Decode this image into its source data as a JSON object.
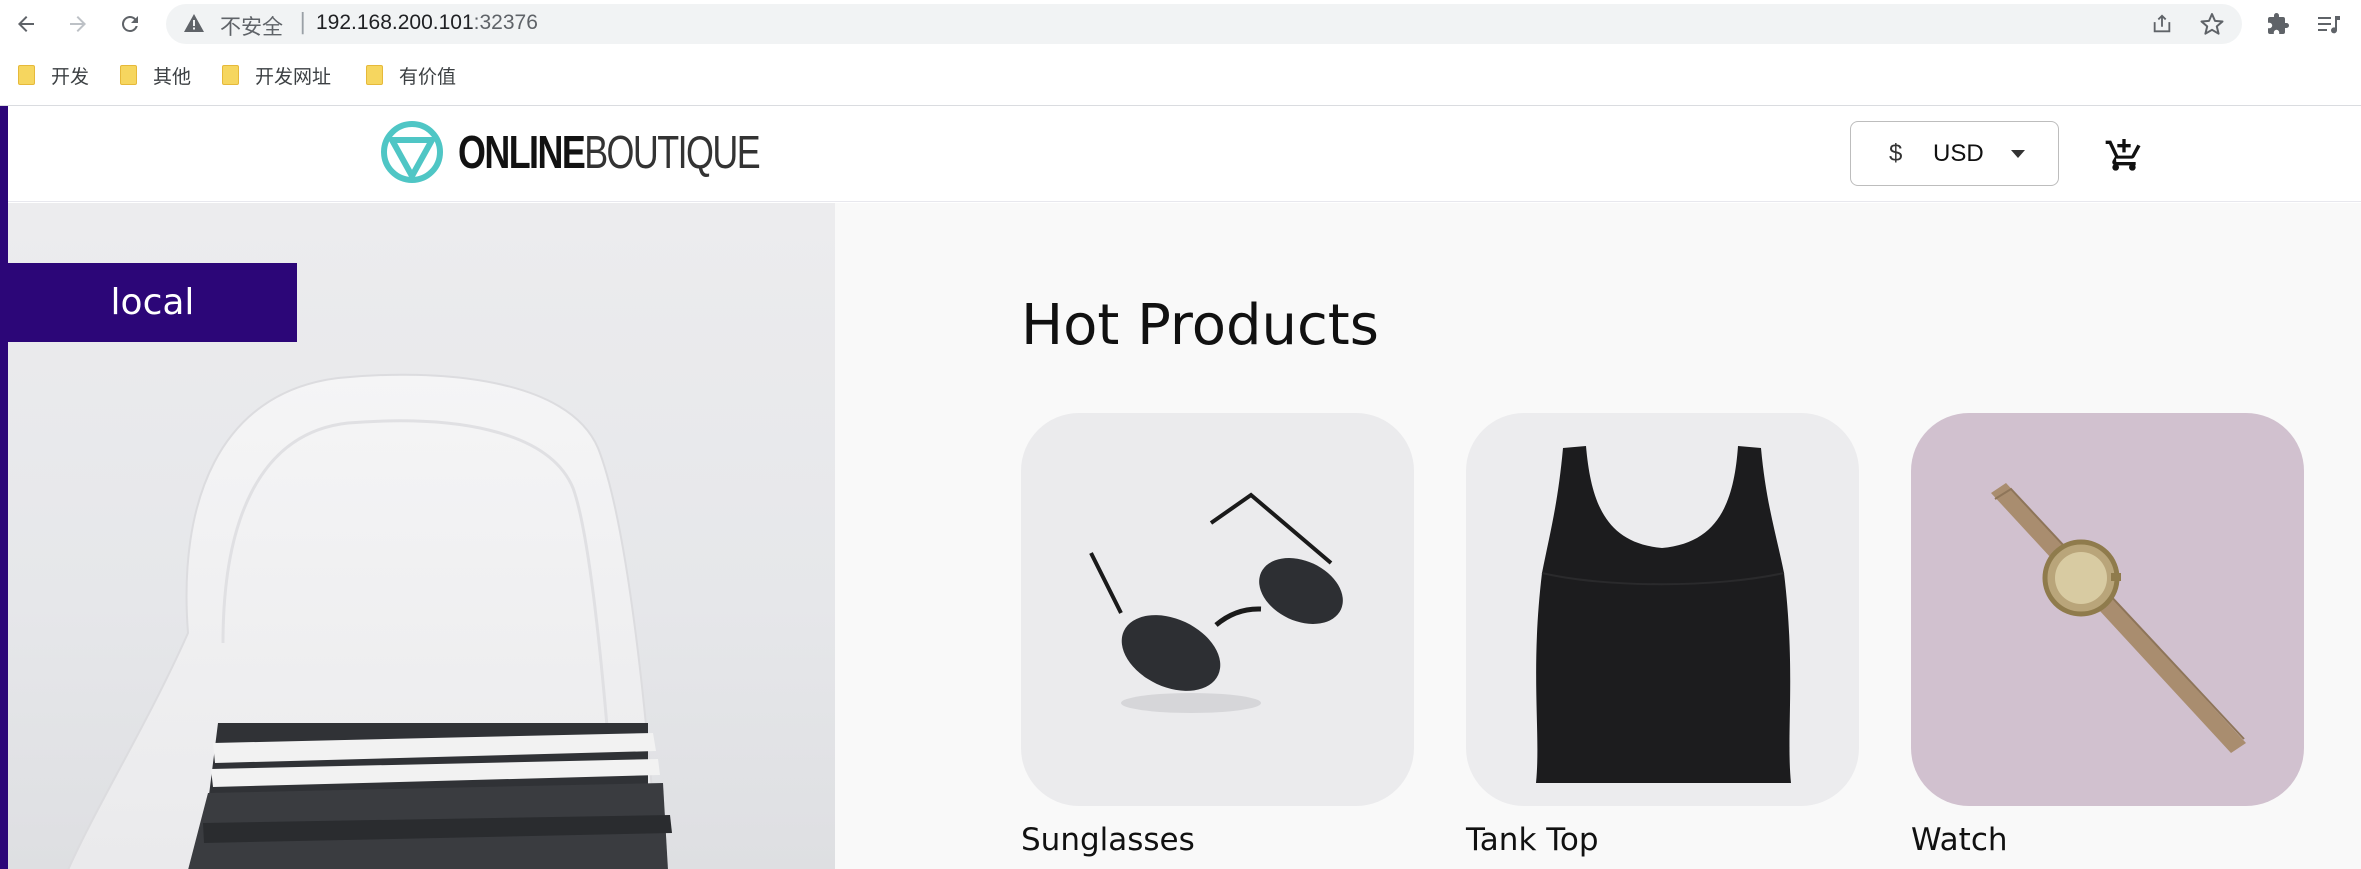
{
  "browser": {
    "security_label": "不安全",
    "separator": "|",
    "host": "192.168.200.101",
    "port": ":32376"
  },
  "bookmarks": [
    {
      "label": "开发"
    },
    {
      "label": "其他"
    },
    {
      "label": "开发网址"
    },
    {
      "label": "有价值"
    }
  ],
  "site": {
    "logo_bold": "ONLINE",
    "logo_light": "BOUTIQUE",
    "currency_symbol": "$",
    "currency_code": "USD"
  },
  "hero": {
    "cluster_label": "local"
  },
  "main": {
    "section_title": "Hot Products",
    "products": [
      {
        "name": "Sunglasses"
      },
      {
        "name": "Tank Top"
      },
      {
        "name": "Watch"
      }
    ]
  },
  "colors": {
    "accent_purple": "#2c0678",
    "logo_teal": "#4fc6c5"
  }
}
